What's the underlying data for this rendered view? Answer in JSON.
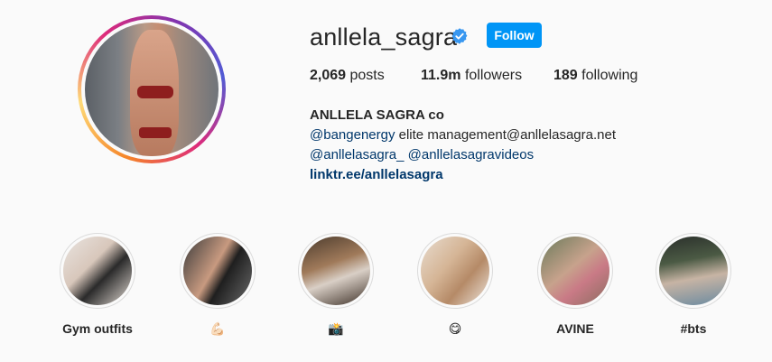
{
  "profile": {
    "username": "anllela_sagra",
    "follow_label": "Follow",
    "posts_count": "2,069",
    "posts_label": "posts",
    "followers_count": "11.9m",
    "followers_label": "followers",
    "following_count": "189",
    "following_label": "following",
    "full_name": "ANLLELA SAGRA co",
    "bio_mention1": "@bangenergy",
    "bio_text1": " elite management@anllelasagra.net",
    "bio_mention2": "@anllelasagra_",
    "bio_mention3": "@anllelasagravideos",
    "bio_link": "linktr.ee/anllelasagra"
  },
  "highlights": [
    {
      "label": "Gym outfits"
    },
    {
      "label": "💪🏻"
    },
    {
      "label": "📸"
    },
    {
      "label": "😋"
    },
    {
      "label": "AVINE"
    },
    {
      "label": "#bts"
    }
  ],
  "colors": {
    "accent": "#0095f6",
    "link": "#00376b",
    "verified": "#3897f0"
  },
  "icons": {
    "verified": "verified-badge-icon"
  }
}
